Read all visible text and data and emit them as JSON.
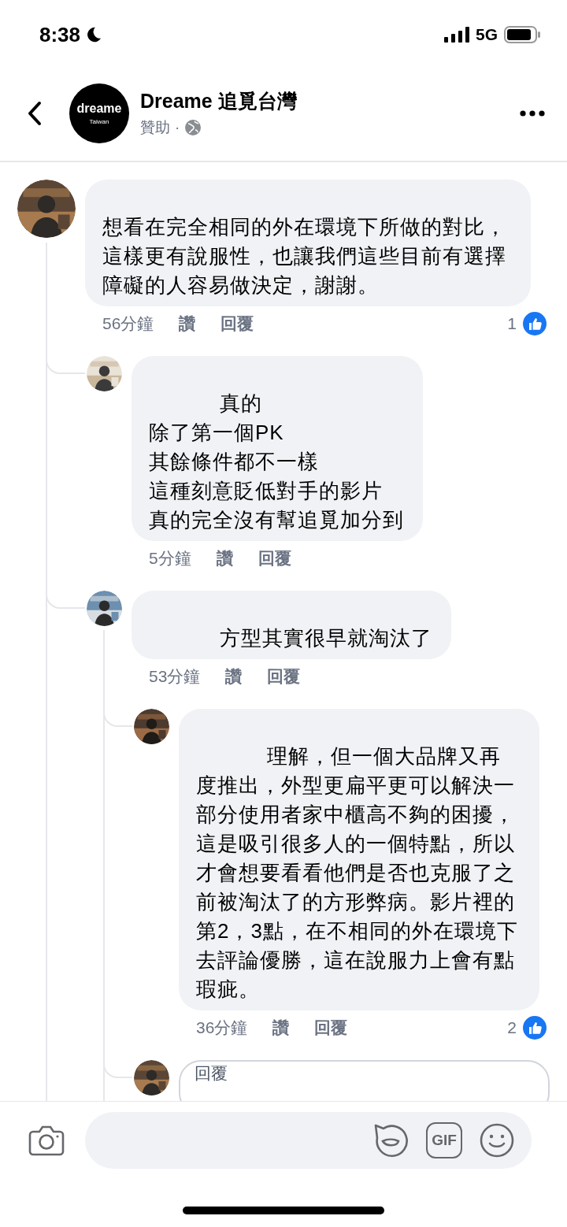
{
  "status_bar": {
    "time": "8:38",
    "network": "5G"
  },
  "header": {
    "logo": {
      "wordmark": "dreame",
      "region": "Taiwan"
    },
    "page_name": "Dreame 追覓台灣",
    "label": "贊助",
    "separator": "·"
  },
  "comments": [
    {
      "text": "想看在完全相同的外在環境下所做的對比，這樣更有說服性，也讓我們這些目前有選擇障礙的人容易做決定，謝謝。",
      "time": "56分鐘",
      "like": "讚",
      "reply": "回覆",
      "reaction_count": "1",
      "children": [
        {
          "lines": [
            "真的",
            "除了第一個PK",
            "其餘條件都不一樣",
            "這種刻意貶低對手的影片",
            "真的完全沒有幫追覓加分到"
          ],
          "time": "5分鐘",
          "like": "讚",
          "reply": "回覆"
        },
        {
          "text": "方型其實很早就淘汰了",
          "time": "53分鐘",
          "like": "讚",
          "reply": "回覆",
          "reply_field": {
            "placeholder": "回覆"
          },
          "children": [
            {
              "text": "理解，但一個大品牌又再度推出，外型更扁平更可以解決一部分使用者家中櫃高不夠的困擾，這是吸引很多人的一個特點，所以才會想要看看他們是否也克服了之前被淘汰了的方形弊病。影片裡的第2，3點，在不相同的外在環境下去評論優勝，這在說服力上會有點瑕疵。",
              "time": "36分鐘",
              "like": "讚",
              "reply": "回覆",
              "reaction_count": "2"
            }
          ]
        }
      ]
    }
  ],
  "composer": {
    "gif_label": "GIF"
  }
}
